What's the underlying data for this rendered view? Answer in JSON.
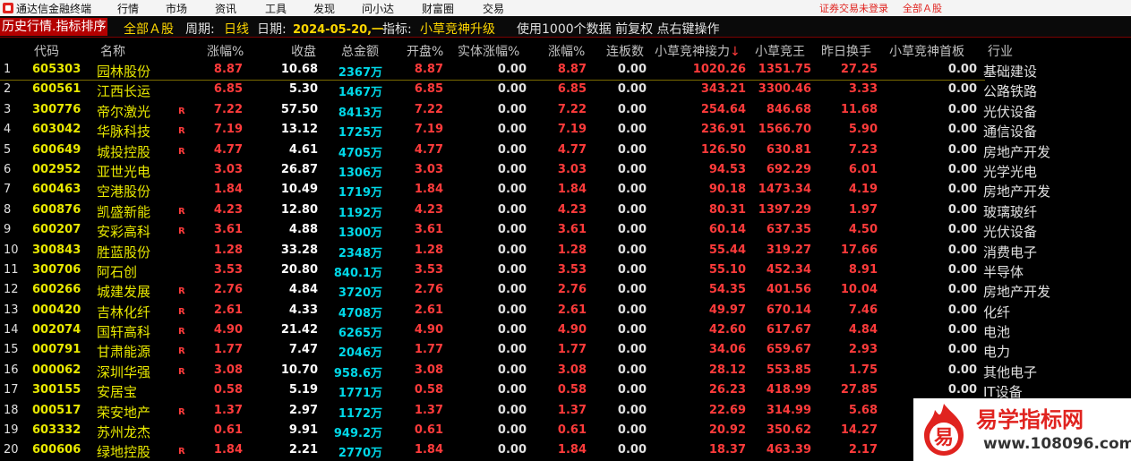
{
  "menubar": {
    "app_title": "通达信金融终端",
    "items": [
      "行情",
      "市场",
      "资讯",
      "工具",
      "发现",
      "问小达",
      "财富圈",
      "交易"
    ],
    "login_status": "证券交易未登录",
    "market_link": "全部Ａ股"
  },
  "infobar": {
    "history_tag": "历史行情.指标排序",
    "market": "全部Ａ股",
    "period_label": "周期:",
    "period_value": "日线",
    "date_label": "日期:",
    "date_value": "2024-05-20,一",
    "indicator_label": "指标:",
    "indicator_value": "小草竞神升级",
    "note": "使用1000个数据 前复权 点右键操作"
  },
  "table": {
    "headers": {
      "code": "代码",
      "name": "名称",
      "change_pct": "涨幅%",
      "close": "收盘",
      "amount": "总金额",
      "open_pct": "开盘%",
      "body_pct": "实体涨幅%",
      "change_pct2": "涨幅%",
      "limit_days": "连板数",
      "relay": "小草竞神接力",
      "relay_arrow": "↓",
      "king": "小草竞王",
      "turnover": "昨日换手",
      "first_board": "小草竞神首板",
      "industry": "行业"
    },
    "rows": [
      {
        "idx": "1",
        "code": "605303",
        "name": "园林股份",
        "r": "",
        "chg": "8.87",
        "close": "10.68",
        "amt": "2367万",
        "open": "8.87",
        "body": "0.00",
        "chg2": "8.87",
        "lb": "0.00",
        "relay": "1020.26",
        "king": "1351.75",
        "turn": "27.25",
        "first": "0.00",
        "ind": "基础建设"
      },
      {
        "idx": "2",
        "code": "600561",
        "name": "江西长运",
        "r": "",
        "chg": "6.85",
        "close": "5.30",
        "amt": "1467万",
        "open": "6.85",
        "body": "0.00",
        "chg2": "6.85",
        "lb": "0.00",
        "relay": "343.21",
        "king": "3300.46",
        "turn": "3.33",
        "first": "0.00",
        "ind": "公路铁路"
      },
      {
        "idx": "3",
        "code": "300776",
        "name": "帝尔激光",
        "r": "R",
        "chg": "7.22",
        "close": "57.50",
        "amt": "8413万",
        "open": "7.22",
        "body": "0.00",
        "chg2": "7.22",
        "lb": "0.00",
        "relay": "254.64",
        "king": "846.68",
        "turn": "11.68",
        "first": "0.00",
        "ind": "光伏设备"
      },
      {
        "idx": "4",
        "code": "603042",
        "name": "华脉科技",
        "r": "R",
        "chg": "7.19",
        "close": "13.12",
        "amt": "1725万",
        "open": "7.19",
        "body": "0.00",
        "chg2": "7.19",
        "lb": "0.00",
        "relay": "236.91",
        "king": "1566.70",
        "turn": "5.90",
        "first": "0.00",
        "ind": "通信设备"
      },
      {
        "idx": "5",
        "code": "600649",
        "name": "城投控股",
        "r": "R",
        "chg": "4.77",
        "close": "4.61",
        "amt": "4705万",
        "open": "4.77",
        "body": "0.00",
        "chg2": "4.77",
        "lb": "0.00",
        "relay": "126.50",
        "king": "630.81",
        "turn": "7.23",
        "first": "0.00",
        "ind": "房地产开发"
      },
      {
        "idx": "6",
        "code": "002952",
        "name": "亚世光电",
        "r": "",
        "chg": "3.03",
        "close": "26.87",
        "amt": "1306万",
        "open": "3.03",
        "body": "0.00",
        "chg2": "3.03",
        "lb": "0.00",
        "relay": "94.53",
        "king": "692.29",
        "turn": "6.01",
        "first": "0.00",
        "ind": "光学光电"
      },
      {
        "idx": "7",
        "code": "600463",
        "name": "空港股份",
        "r": "",
        "chg": "1.84",
        "close": "10.49",
        "amt": "1719万",
        "open": "1.84",
        "body": "0.00",
        "chg2": "1.84",
        "lb": "0.00",
        "relay": "90.18",
        "king": "1473.34",
        "turn": "4.19",
        "first": "0.00",
        "ind": "房地产开发"
      },
      {
        "idx": "8",
        "code": "600876",
        "name": "凯盛新能",
        "r": "R",
        "chg": "4.23",
        "close": "12.80",
        "amt": "1192万",
        "open": "4.23",
        "body": "0.00",
        "chg2": "4.23",
        "lb": "0.00",
        "relay": "80.31",
        "king": "1397.29",
        "turn": "1.97",
        "first": "0.00",
        "ind": "玻璃玻纤"
      },
      {
        "idx": "9",
        "code": "600207",
        "name": "安彩高科",
        "r": "R",
        "chg": "3.61",
        "close": "4.88",
        "amt": "1300万",
        "open": "3.61",
        "body": "0.00",
        "chg2": "3.61",
        "lb": "0.00",
        "relay": "60.14",
        "king": "637.35",
        "turn": "4.50",
        "first": "0.00",
        "ind": "光伏设备"
      },
      {
        "idx": "10",
        "code": "300843",
        "name": "胜蓝股份",
        "r": "",
        "chg": "1.28",
        "close": "33.28",
        "amt": "2348万",
        "open": "1.28",
        "body": "0.00",
        "chg2": "1.28",
        "lb": "0.00",
        "relay": "55.44",
        "king": "319.27",
        "turn": "17.66",
        "first": "0.00",
        "ind": "消费电子"
      },
      {
        "idx": "11",
        "code": "300706",
        "name": "阿石创",
        "r": "",
        "chg": "3.53",
        "close": "20.80",
        "amt": "840.1万",
        "open": "3.53",
        "body": "0.00",
        "chg2": "3.53",
        "lb": "0.00",
        "relay": "55.10",
        "king": "452.34",
        "turn": "8.91",
        "first": "0.00",
        "ind": "半导体"
      },
      {
        "idx": "12",
        "code": "600266",
        "name": "城建发展",
        "r": "R",
        "chg": "2.76",
        "close": "4.84",
        "amt": "3720万",
        "open": "2.76",
        "body": "0.00",
        "chg2": "2.76",
        "lb": "0.00",
        "relay": "54.35",
        "king": "401.56",
        "turn": "10.04",
        "first": "0.00",
        "ind": "房地产开发"
      },
      {
        "idx": "13",
        "code": "000420",
        "name": "吉林化纤",
        "r": "R",
        "chg": "2.61",
        "close": "4.33",
        "amt": "4708万",
        "open": "2.61",
        "body": "0.00",
        "chg2": "2.61",
        "lb": "0.00",
        "relay": "49.97",
        "king": "670.14",
        "turn": "7.46",
        "first": "0.00",
        "ind": "化纤"
      },
      {
        "idx": "14",
        "code": "002074",
        "name": "国轩高科",
        "r": "R",
        "chg": "4.90",
        "close": "21.42",
        "amt": "6265万",
        "open": "4.90",
        "body": "0.00",
        "chg2": "4.90",
        "lb": "0.00",
        "relay": "42.60",
        "king": "617.67",
        "turn": "4.84",
        "first": "0.00",
        "ind": "电池"
      },
      {
        "idx": "15",
        "code": "000791",
        "name": "甘肃能源",
        "r": "R",
        "chg": "1.77",
        "close": "7.47",
        "amt": "2046万",
        "open": "1.77",
        "body": "0.00",
        "chg2": "1.77",
        "lb": "0.00",
        "relay": "34.06",
        "king": "659.67",
        "turn": "2.93",
        "first": "0.00",
        "ind": "电力"
      },
      {
        "idx": "16",
        "code": "000062",
        "name": "深圳华强",
        "r": "R",
        "chg": "3.08",
        "close": "10.70",
        "amt": "958.6万",
        "open": "3.08",
        "body": "0.00",
        "chg2": "3.08",
        "lb": "0.00",
        "relay": "28.12",
        "king": "553.85",
        "turn": "1.75",
        "first": "0.00",
        "ind": "其他电子"
      },
      {
        "idx": "17",
        "code": "300155",
        "name": "安居宝",
        "r": "",
        "chg": "0.58",
        "close": "5.19",
        "amt": "1771万",
        "open": "0.58",
        "body": "0.00",
        "chg2": "0.58",
        "lb": "0.00",
        "relay": "26.23",
        "king": "418.99",
        "turn": "27.85",
        "first": "0.00",
        "ind": "IT设备"
      },
      {
        "idx": "18",
        "code": "000517",
        "name": "荣安地产",
        "r": "R",
        "chg": "1.37",
        "close": "2.97",
        "amt": "1172万",
        "open": "1.37",
        "body": "0.00",
        "chg2": "1.37",
        "lb": "0.00",
        "relay": "22.69",
        "king": "314.99",
        "turn": "5.68",
        "first": "",
        "ind": ""
      },
      {
        "idx": "19",
        "code": "603332",
        "name": "苏州龙杰",
        "r": "",
        "chg": "0.61",
        "close": "9.91",
        "amt": "949.2万",
        "open": "0.61",
        "body": "0.00",
        "chg2": "0.61",
        "lb": "0.00",
        "relay": "20.92",
        "king": "350.62",
        "turn": "14.27",
        "first": "",
        "ind": ""
      },
      {
        "idx": "20",
        "code": "600606",
        "name": "绿地控股",
        "r": "R",
        "chg": "1.84",
        "close": "2.21",
        "amt": "2770万",
        "open": "1.84",
        "body": "0.00",
        "chg2": "1.84",
        "lb": "0.00",
        "relay": "18.37",
        "king": "463.39",
        "turn": "2.17",
        "first": "",
        "ind": ""
      }
    ]
  },
  "watermark": {
    "logo_char": "易",
    "title": "易学指标网",
    "url": "www.108096.com"
  },
  "colors": {
    "up_red": "#ff3b3b",
    "code_yellow": "#e8e800",
    "amount_cyan": "#00d8e8",
    "history_tag_bg": "#b40000",
    "background": "#000000"
  }
}
